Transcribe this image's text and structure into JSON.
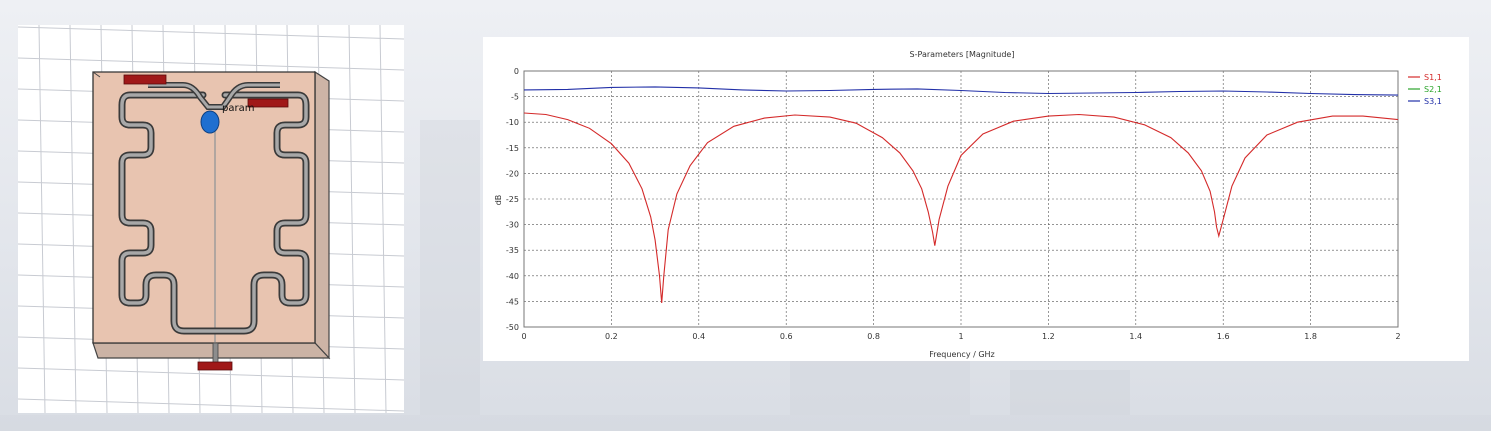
{
  "viewport": {
    "port_label": "param",
    "colors": {
      "substrate": "#e8c4b0",
      "trace": "#9a9a9a",
      "port": "#a01818",
      "probe": "#1f6fd0",
      "grid": "#c8cbd2"
    }
  },
  "chart_data": {
    "type": "line",
    "title": "S-Parameters [Magnitude]",
    "xlabel": "Frequency / GHz",
    "ylabel": "dB",
    "xlim": [
      0,
      2
    ],
    "ylim": [
      -50,
      0
    ],
    "x_ticks": [
      "0",
      "0.2",
      "0.4",
      "0.6",
      "0.8",
      "1",
      "1.2",
      "1.4",
      "1.6",
      "1.8",
      "2"
    ],
    "y_ticks": [
      "0",
      "-5",
      "-10",
      "-15",
      "-20",
      "-25",
      "-30",
      "-35",
      "-40",
      "-45",
      "-50"
    ],
    "grid": true,
    "legend_position": "right",
    "series": [
      {
        "name": "S1,1",
        "color": "#d42a2a",
        "x": [
          0,
          0.05,
          0.1,
          0.15,
          0.2,
          0.24,
          0.27,
          0.29,
          0.3,
          0.31,
          0.315,
          0.32,
          0.33,
          0.35,
          0.38,
          0.42,
          0.48,
          0.55,
          0.62,
          0.7,
          0.76,
          0.82,
          0.86,
          0.89,
          0.91,
          0.925,
          0.935,
          0.94,
          0.95,
          0.97,
          1.0,
          1.05,
          1.12,
          1.2,
          1.27,
          1.35,
          1.42,
          1.48,
          1.52,
          1.55,
          1.57,
          1.58,
          1.585,
          1.59,
          1.6,
          1.62,
          1.65,
          1.7,
          1.77,
          1.85,
          1.92,
          2.0
        ],
        "y": [
          -8.2,
          -8.5,
          -9.5,
          -11.2,
          -14.2,
          -18,
          -23,
          -28.5,
          -33,
          -40,
          -45.3,
          -40,
          -31,
          -24,
          -18.5,
          -14,
          -10.8,
          -9.2,
          -8.6,
          -9,
          -10.2,
          -13,
          -16,
          -19.5,
          -23,
          -27.5,
          -31.5,
          -34.1,
          -29,
          -22.5,
          -16.5,
          -12.3,
          -9.8,
          -8.8,
          -8.5,
          -9,
          -10.5,
          -13,
          -16,
          -19.5,
          -23.5,
          -27.5,
          -30.5,
          -32.2,
          -29,
          -22.5,
          -17,
          -12.5,
          -10,
          -8.8,
          -8.8,
          -9.5
        ]
      },
      {
        "name": "S2,1",
        "color": "#2aa42a",
        "x": [],
        "y": []
      },
      {
        "name": "S3,1",
        "color": "#2230a8",
        "x": [
          0,
          0.1,
          0.2,
          0.3,
          0.4,
          0.5,
          0.6,
          0.7,
          0.8,
          0.9,
          1.0,
          1.1,
          1.2,
          1.3,
          1.4,
          1.5,
          1.6,
          1.7,
          1.8,
          1.9,
          2.0
        ],
        "y": [
          -3.7,
          -3.6,
          -3.2,
          -3.1,
          -3.3,
          -3.7,
          -3.9,
          -3.8,
          -3.6,
          -3.5,
          -3.8,
          -4.2,
          -4.4,
          -4.3,
          -4.2,
          -4.0,
          -3.9,
          -4.1,
          -4.4,
          -4.6,
          -4.7
        ]
      }
    ]
  }
}
